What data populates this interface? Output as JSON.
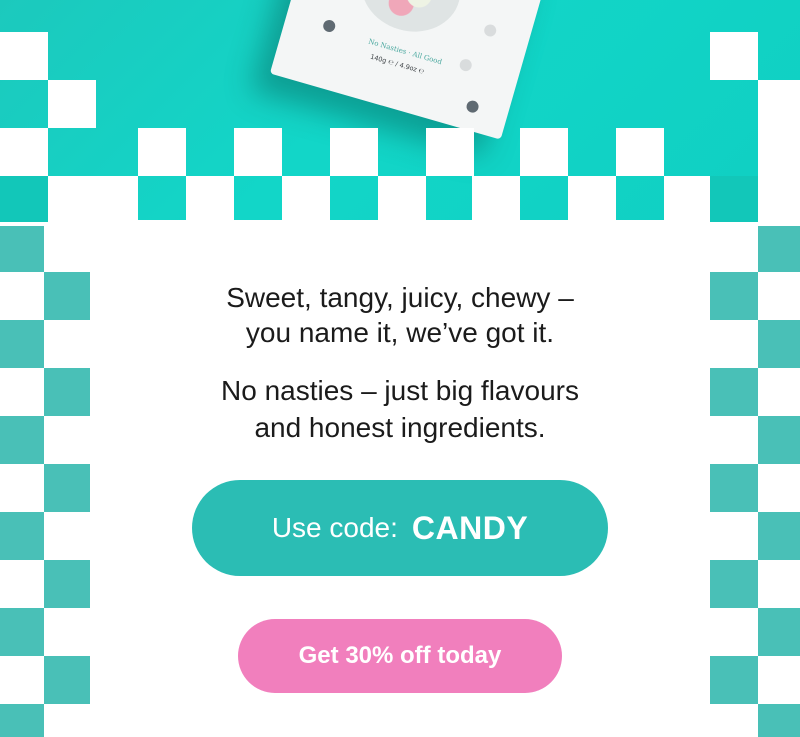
{
  "hero": {
    "product_tagline": "No Nasties · All Good",
    "product_weight": "140g ℮ / 4.9oz ℮"
  },
  "message": {
    "paragraph1_line1": "Sweet, tangy, juicy, chewy –",
    "paragraph1_line2": "you name it, we’ve got it.",
    "paragraph2_line1": "No nasties – just big flavours",
    "paragraph2_line2": "and honest ingredients."
  },
  "promo": {
    "label": "Use code:",
    "code": "CANDY"
  },
  "cta": {
    "label": "Get 30% off today"
  },
  "colors": {
    "teal_background": "#12d6c8",
    "code_pill": "#2bbdb4",
    "cta_pink": "#f17fbd",
    "side_checker": "#49c0b7"
  }
}
